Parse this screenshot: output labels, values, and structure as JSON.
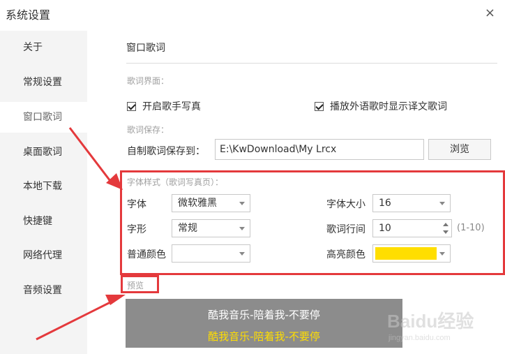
{
  "window": {
    "title": "系统设置",
    "close_label": "×"
  },
  "sidebar": {
    "items": [
      {
        "label": "关于"
      },
      {
        "label": "常规设置"
      },
      {
        "label": "窗口歌词",
        "active": true
      },
      {
        "label": "桌面歌词"
      },
      {
        "label": "本地下载"
      },
      {
        "label": "快捷键"
      },
      {
        "label": "网络代理"
      },
      {
        "label": "音频设置"
      }
    ]
  },
  "main": {
    "section_title": "窗口歌词",
    "lyrics_ui": {
      "group_label": "歌词界面：",
      "show_singer_photo": {
        "label": "开启歌手写真",
        "checked": true
      },
      "show_translation": {
        "label": "播放外语歌时显示译文歌词",
        "checked": true
      }
    },
    "lyrics_save": {
      "group_label": "歌词保存：",
      "path_label": "自制歌词保存到：",
      "path_value": "E:\\KwDownload\\My Lrcx",
      "browse_label": "浏览"
    },
    "font_style": {
      "group_label": "字体样式（歌词写真页）：",
      "font_label": "字体",
      "font_value": "微软雅黑",
      "font_size_label": "字体大小",
      "font_size_value": "16",
      "font_shape_label": "字形",
      "font_shape_value": "常规",
      "line_spacing_label": "歌词行间",
      "line_spacing_value": "10",
      "line_spacing_range": "(1-10)",
      "normal_color_label": "普通颜色",
      "highlight_color_label": "高亮颜色",
      "highlight_color": "#ffde00"
    },
    "preview": {
      "label": "预览",
      "line1": "酷我音乐-陪着我-不要停",
      "line2": "酷我音乐-陪着我-不要停",
      "line1_color": "#ffffff",
      "line2_color": "#ffde00"
    }
  },
  "annotation_color": "#e4393c",
  "watermark": {
    "main": "Baidu经验",
    "sub": "jingyan.baidu.com"
  }
}
